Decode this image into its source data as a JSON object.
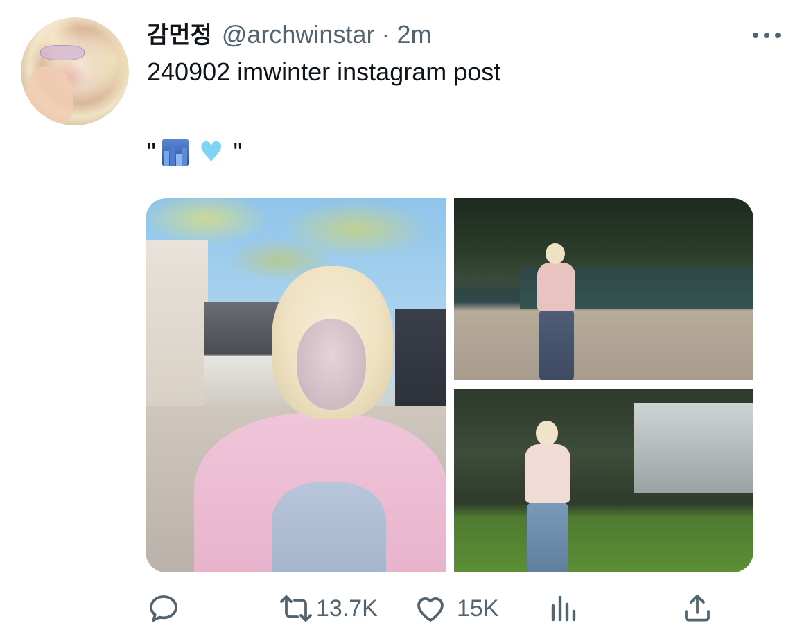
{
  "author": {
    "display_name": "감먼정",
    "handle": "@archwinstar",
    "separator": "·",
    "time": "2m"
  },
  "tweet": {
    "line1": "240902 imwinter instagram post",
    "quote_open": "\"",
    "quote_close": "\"",
    "emoji_1": "city-skyline-emoji",
    "emoji_2": "light-blue-heart-emoji",
    "heart_glyph": "♥"
  },
  "media": {
    "count": 3,
    "photos": [
      "photo-main",
      "photo-top-right",
      "photo-bottom-right"
    ]
  },
  "actions": {
    "reply_count": "",
    "retweet_count": "13.7K",
    "like_count": "15K",
    "views_count": "",
    "icons": [
      "reply-icon",
      "retweet-icon",
      "like-icon",
      "views-icon",
      "share-icon"
    ]
  },
  "colors": {
    "text_primary": "#0f1419",
    "text_secondary": "#536471",
    "heart_emoji": "#7fd4f5"
  }
}
